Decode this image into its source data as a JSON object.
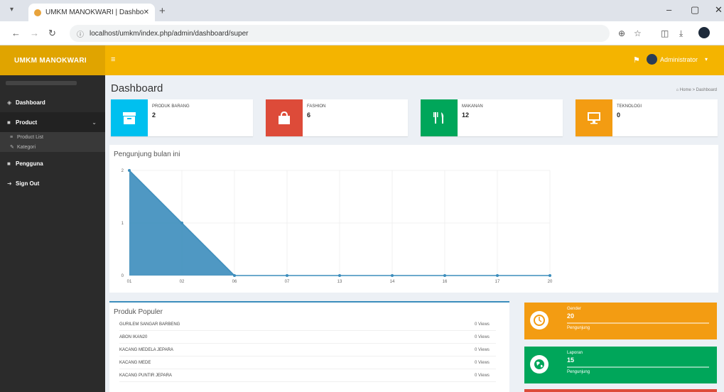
{
  "browser": {
    "tab_title": "UMKM MANOKWARI | Dashbo",
    "tab_close": "✕",
    "new_tab": "+",
    "url": "localhost/umkm/index.php/admin/dashboard/super",
    "win_minimize": "–",
    "win_restore": "▢",
    "win_close": "✕"
  },
  "header": {
    "brand": "UMKM MANOKWARI",
    "user_name": "Administrator",
    "notification_count": ""
  },
  "sidebar": {
    "items": [
      {
        "label": "Dashboard",
        "icon": "dashboard-icon"
      },
      {
        "label": "Product",
        "icon": "product-icon"
      },
      {
        "label": "Pengguna",
        "icon": "users-icon"
      },
      {
        "label": "Sign Out",
        "icon": "signout-icon"
      }
    ],
    "sub_items": [
      {
        "label": "Product List"
      },
      {
        "label": "Kategori"
      }
    ]
  },
  "page": {
    "title": "Dashboard",
    "breadcrumb_home": "Home",
    "breadcrumb_current": "Dashboard"
  },
  "info_boxes": [
    {
      "label": "PRODUK BARANG",
      "value": "2",
      "color": "#00c0ef",
      "icon": "archive-icon"
    },
    {
      "label": "FASHION",
      "value": "6",
      "color": "#dd4b39",
      "icon": "bag-icon"
    },
    {
      "label": "MAKANAN",
      "value": "12",
      "color": "#00a65a",
      "icon": "cutlery-icon"
    },
    {
      "label": "TEKNOLOGI",
      "value": "0",
      "color": "#f39c12",
      "icon": "monitor-icon"
    }
  ],
  "chart": {
    "title": "Pengunjung bulan ini"
  },
  "chart_data": {
    "type": "area",
    "title": "Pengunjung bulan ini",
    "x": [
      "01",
      "02",
      "06",
      "07",
      "13",
      "14",
      "16",
      "17",
      "20"
    ],
    "values": [
      2,
      1,
      0,
      0,
      0,
      0,
      0,
      0,
      0
    ],
    "yticks": [
      "0",
      "1",
      "2"
    ],
    "ylim": [
      0,
      2
    ],
    "color": "#3c8dbc",
    "grid": true
  },
  "popular": {
    "title": "Produk Populer",
    "rows": [
      {
        "name": "GURILEM SANGAR BARBENG",
        "views": "0 Views"
      },
      {
        "name": "ABON IKAN20",
        "views": "0 Views"
      },
      {
        "name": "KACANG MEDELA JEPARA",
        "views": "0 Views"
      },
      {
        "name": "KACANG MEDE",
        "views": "0 Views"
      },
      {
        "name": "KACANG PUNTIR JEPARA",
        "views": "0 Views"
      }
    ]
  },
  "stats": [
    {
      "title": "Gender",
      "value": "20",
      "bottom": "Pengunjung",
      "color": "#f39c12",
      "icon": "clock-icon"
    },
    {
      "title": "Laporan",
      "value": "15",
      "bottom": "Pengunjung",
      "color": "#00a65a",
      "icon": "globe-icon"
    }
  ]
}
